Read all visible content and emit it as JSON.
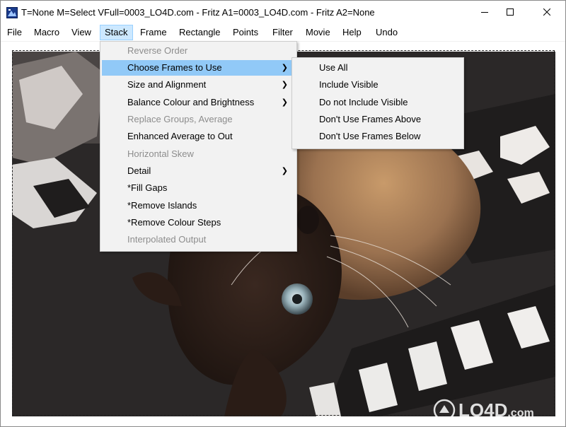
{
  "window": {
    "title": "T=None M=Select VFull=0003_LO4D.com - Fritz A1=0003_LO4D.com - Fritz A2=None"
  },
  "menubar": {
    "items": [
      "File",
      "Macro",
      "View",
      "Stack",
      "Frame",
      "Rectangle",
      "Points",
      "Filter",
      "Movie",
      "Help",
      "Undo"
    ],
    "active": "Stack"
  },
  "stack_menu": {
    "items": [
      {
        "label": "Reverse Order",
        "enabled": false,
        "submenu": false
      },
      {
        "label": "Choose Frames to Use",
        "enabled": true,
        "submenu": true,
        "highlighted": true
      },
      {
        "label": "Size and Alignment",
        "enabled": true,
        "submenu": true
      },
      {
        "label": "Balance Colour and Brightness",
        "enabled": true,
        "submenu": true
      },
      {
        "label": "Replace Groups, Average",
        "enabled": false,
        "submenu": false
      },
      {
        "label": "Enhanced Average to Out",
        "enabled": true,
        "submenu": false
      },
      {
        "label": "Horizontal Skew",
        "enabled": false,
        "submenu": false
      },
      {
        "label": "Detail",
        "enabled": true,
        "submenu": true
      },
      {
        "label": "*Fill Gaps",
        "enabled": true,
        "submenu": false
      },
      {
        "label": "*Remove Islands",
        "enabled": true,
        "submenu": false
      },
      {
        "label": "*Remove Colour Steps",
        "enabled": true,
        "submenu": false
      },
      {
        "label": "Interpolated Output",
        "enabled": false,
        "submenu": false
      }
    ]
  },
  "choose_frames_submenu": {
    "items": [
      "Use All",
      "Include Visible",
      "Do not Include Visible",
      "Don't Use Frames Above",
      "Don't Use Frames Below"
    ]
  },
  "watermark": {
    "text": "LO4D",
    "suffix": ".com"
  },
  "colors": {
    "menu_highlight": "#91c9f7",
    "menubar_active": "#cce8ff",
    "disabled_text": "#8d8d8d"
  },
  "icons": [
    "app-icon",
    "minimize-icon",
    "maximize-icon",
    "close-icon",
    "chevron-right-icon",
    "lo4d-logo-icon"
  ]
}
